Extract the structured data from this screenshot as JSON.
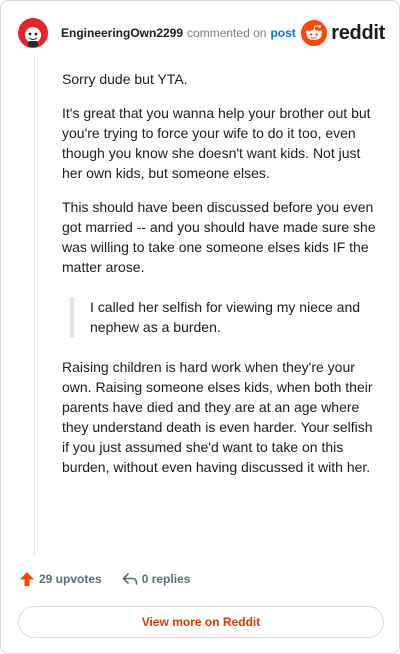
{
  "header": {
    "username": "EngineeringOwn2299",
    "verb": "commented on",
    "post_link": "post",
    "brand": "reddit"
  },
  "comment": {
    "paragraphs": [
      "Sorry dude but YTA.",
      "It's great that you wanna help your brother out but you're trying to force your wife to do it too, even though you know she doesn't want kids. Not just her own kids, but someone elses.",
      "This should have been discussed before you even got married -- and you should have made sure she was willing to take one someone elses kids IF the matter arose."
    ],
    "quote": "I called her selfish for viewing my niece and nephew as a burden.",
    "closing": "Raising children is hard work when they're your own. Raising someone elses kids, when both their parents have died and they are at an age where they understand death is even harder. Your selfish if you just assumed she'd want to take on this burden, without even having discussed it with her."
  },
  "actions": {
    "upvotes": "29 upvotes",
    "replies": "0 replies"
  },
  "footer": {
    "view_button": "View more on Reddit"
  },
  "colors": {
    "accent": "#d93a00",
    "link": "#0079d3",
    "upvote": "#ff4500"
  },
  "icons": {
    "avatar": "snoo-avatar-red",
    "brand": "reddit-snoo-icon",
    "upvote": "upvote-arrow-icon",
    "reply": "reply-arrow-icon"
  }
}
